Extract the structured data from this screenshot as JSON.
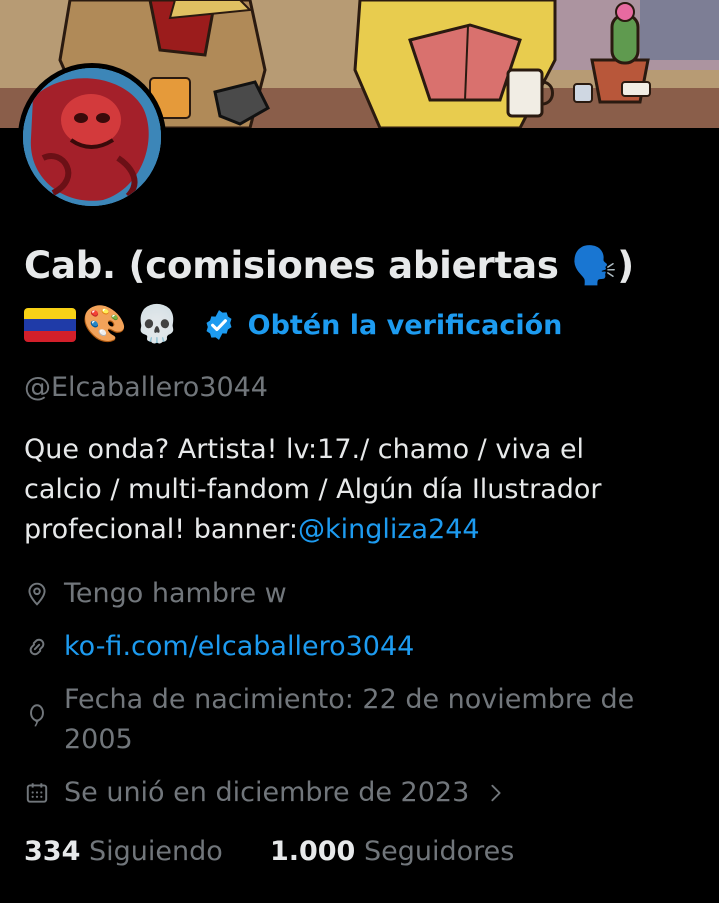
{
  "profile": {
    "display_name": "Cab. (comisiones abiertas 🗣️)",
    "name_emojis": [
      "🎨",
      "💀"
    ],
    "flag": "venezuela-flag",
    "verify_cta": "Obtén la verificación",
    "handle": "@Elcaballero3044",
    "bio": {
      "line1": "Que onda?  Artista! lv:17./ chamo / viva el",
      "line2": "calcio / multi-fandom / Algún día Ilustrador",
      "line3_prefix": "profecional! banner:",
      "line3_mention": "@kingliza244"
    },
    "location": "Tengo hambre w",
    "website": "ko-fi.com/elcaballero3044",
    "birthday_line1": "Fecha de nacimiento: 22 de noviembre de",
    "birthday_line2": "2005",
    "joined": "Se unió en diciembre de 2023",
    "following_count": "334",
    "following_label": "Siguiendo",
    "followers_count": "1.000",
    "followers_label": "Seguidores"
  },
  "icons": {
    "location": "location-pin-icon",
    "website": "link-icon",
    "birthday": "balloon-icon",
    "joined": "calendar-icon",
    "joined_more": "chevron-right-icon",
    "verified": "verified-badge-icon"
  },
  "colors": {
    "background": "#000000",
    "text": "#e7e9ea",
    "muted": "#71767b",
    "accent": "#1d9bf0"
  }
}
